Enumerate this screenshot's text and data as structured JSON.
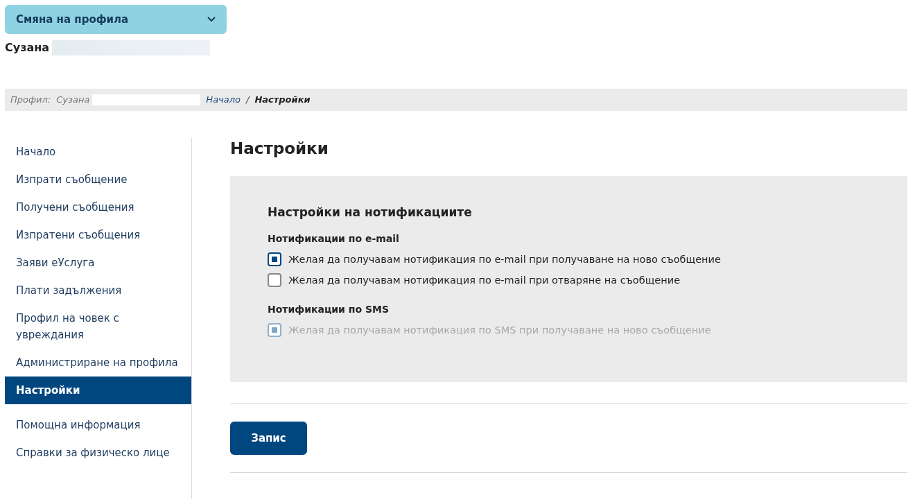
{
  "profile_switcher": {
    "label": "Смяна на профила",
    "expanded": false
  },
  "user_name": "Сузана",
  "breadcrumb": {
    "profile_label": "Профил:",
    "profile_name": "Сузана",
    "separator": "/",
    "items": [
      {
        "label": "Начало",
        "current": false
      },
      {
        "label": "Настройки",
        "current": true
      }
    ]
  },
  "sidebar": {
    "items": [
      {
        "label": "Начало",
        "selected": false
      },
      {
        "label": "Изпрати съобщение",
        "selected": false
      },
      {
        "label": "Получени съобщения",
        "selected": false
      },
      {
        "label": "Изпратени съобщения",
        "selected": false
      },
      {
        "label": "Заяви еУслуга",
        "selected": false
      },
      {
        "label": "Плати задължения",
        "selected": false
      },
      {
        "label": "Профил на човек с увреждания",
        "selected": false
      },
      {
        "label": "Администриране на профила",
        "selected": false
      },
      {
        "label": "Настройки",
        "selected": true
      },
      {
        "label": "Помощна информация",
        "selected": false
      },
      {
        "label": "Справки за физическо лице",
        "selected": false
      }
    ]
  },
  "page_title": "Настройки",
  "panel": {
    "title": "Настройки на нотификациите",
    "groups": [
      {
        "title": "Нотификации по e-mail",
        "options": [
          {
            "label": "Желая да получавам нотификация по e-mail при получаване на ново съобщение",
            "checked": true,
            "disabled": false
          },
          {
            "label": "Желая да получавам нотификация по e-mail при отваряне на съобщение",
            "checked": false,
            "disabled": false
          }
        ]
      },
      {
        "title": "Нотификации по SMS",
        "options": [
          {
            "label": "Желая да получавам нотификация по SMS при получаване на ново съобщение",
            "checked": true,
            "disabled": true
          }
        ]
      }
    ]
  },
  "save_button": "Запис"
}
